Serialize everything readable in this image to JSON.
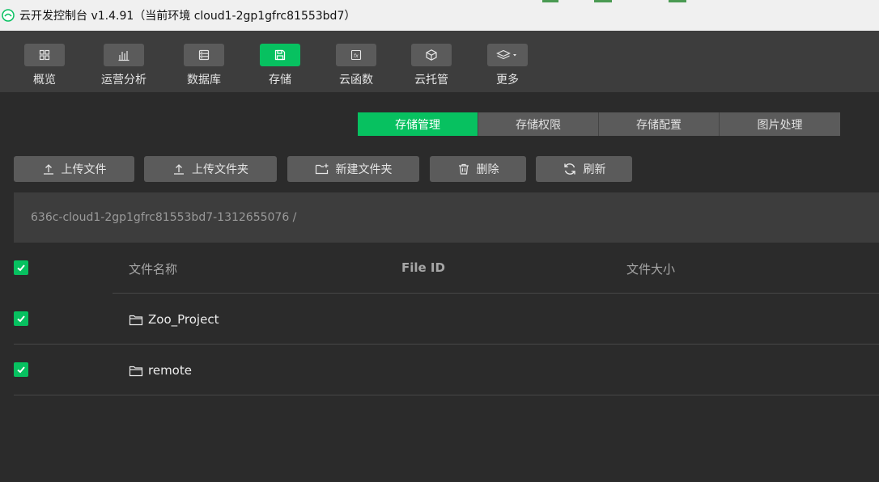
{
  "window": {
    "title": "云开发控制台 v1.4.91（当前环境 cloud1-2gp1gfrc81553bd7）"
  },
  "toolbar": {
    "items": [
      {
        "label": "概览",
        "icon": "grid-icon"
      },
      {
        "label": "运营分析",
        "icon": "bar-chart-icon"
      },
      {
        "label": "数据库",
        "icon": "database-icon"
      },
      {
        "label": "存储",
        "icon": "storage-icon",
        "active": true
      },
      {
        "label": "云函数",
        "icon": "function-icon"
      },
      {
        "label": "云托管",
        "icon": "cube-icon"
      },
      {
        "label": "更多",
        "icon": "layers-icon"
      }
    ]
  },
  "tabs": [
    {
      "label": "存储管理",
      "active": true
    },
    {
      "label": "存储权限"
    },
    {
      "label": "存储配置"
    },
    {
      "label": "图片处理"
    }
  ],
  "actions": {
    "upload_file": "上传文件",
    "upload_folder": "上传文件夹",
    "new_folder": "新建文件夹",
    "delete": "删除",
    "refresh": "刷新"
  },
  "path": "636c-cloud1-2gp1gfrc81553bd7-1312655076 /",
  "table": {
    "columns": [
      "文件名称",
      "File ID",
      "文件大小"
    ],
    "rows": [
      {
        "name": "Zoo_Project",
        "type": "folder",
        "checked": true
      },
      {
        "name": "remote",
        "type": "folder",
        "checked": true
      }
    ]
  },
  "colors": {
    "accent": "#07c160",
    "background": "#2b2b2b",
    "toolbar": "#3d3d3d",
    "button": "#5b5b5b"
  }
}
